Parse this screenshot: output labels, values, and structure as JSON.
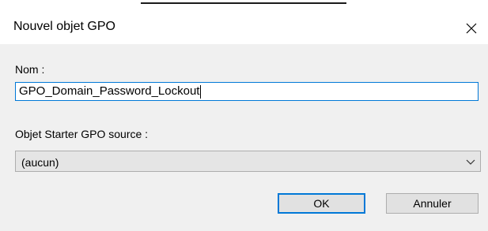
{
  "dialog": {
    "title": "Nouvel objet GPO",
    "close_icon": "close-icon"
  },
  "name_field": {
    "label": "Nom :",
    "value": "GPO_Domain_Password_Lockout"
  },
  "starter_field": {
    "label": "Objet Starter GPO source :",
    "selected": "(aucun)",
    "dropdown_icon": "chevron-down-icon"
  },
  "buttons": {
    "ok_label": "OK",
    "cancel_label": "Annuler"
  },
  "colors": {
    "accent": "#0078d7",
    "content_bg": "#f0f0f0",
    "button_bg": "#e1e1e1",
    "select_bg": "#e5e5e5",
    "border": "#adadad"
  }
}
